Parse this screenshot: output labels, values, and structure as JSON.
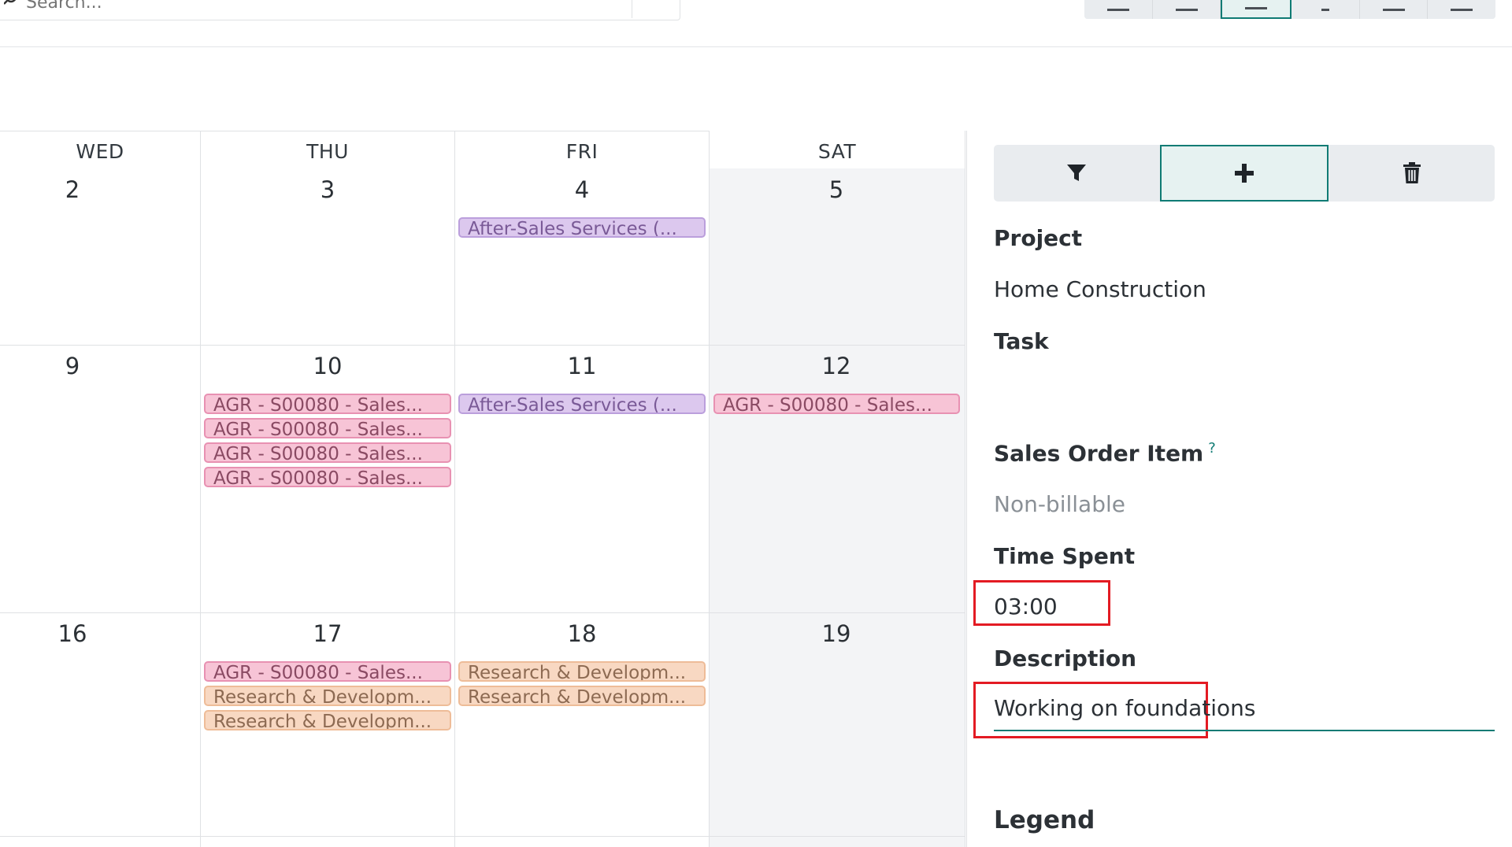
{
  "search": {
    "placeholder": "Search..."
  },
  "calendar": {
    "days": [
      {
        "name": "WED",
        "dates": [
          "2",
          "9",
          "16"
        ]
      },
      {
        "name": "THU",
        "dates": [
          "3",
          "10",
          "17"
        ]
      },
      {
        "name": "FRI",
        "dates": [
          "4",
          "11",
          "18"
        ]
      },
      {
        "name": "SAT",
        "dates": [
          "5",
          "12",
          "19"
        ]
      }
    ],
    "events": {
      "fri_4": "After-Sales Services (...",
      "thu_10": [
        "AGR - S00080 - Sales...",
        "AGR - S00080 - Sales...",
        "AGR - S00080 - Sales...",
        "AGR - S00080 - Sales..."
      ],
      "fri_11": "After-Sales Services (...",
      "sat_12": "AGR - S00080 - Sales...",
      "thu_17": [
        "AGR - S00080 - Sales...",
        "Research & Developm...",
        "Research & Developm..."
      ],
      "fri_18": [
        "Research & Developm...",
        "Research & Developm..."
      ]
    },
    "colors": {
      "agr": "#f7c4d6",
      "after_sales": "#dcc8ee",
      "research": "#f8d8c2"
    }
  },
  "panel": {
    "project_label": "Project",
    "project_value": "Home Construction",
    "task_label": "Task",
    "sales_order_label": "Sales Order Item",
    "sales_order_help": "?",
    "sales_order_value": "Non-billable",
    "time_spent_label": "Time Spent",
    "time_spent_value": "03:00",
    "description_label": "Description",
    "description_value": "Working on foundations",
    "legend_label": "Legend"
  },
  "accent_color": "#0f7b74",
  "highlight_color": "#e31b23"
}
